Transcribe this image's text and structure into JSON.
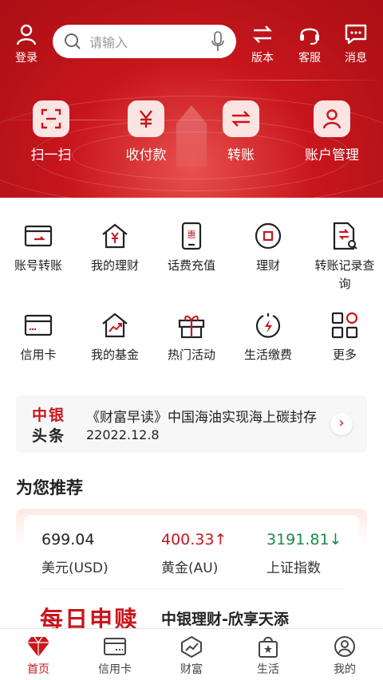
{
  "header": {
    "login_label": "登录",
    "search_placeholder": "请输入",
    "version_label": "版本",
    "service_label": "客服",
    "message_label": "消息"
  },
  "quick_actions": [
    {
      "label": "扫一扫",
      "icon": "scan-icon"
    },
    {
      "label": "收付款",
      "icon": "yuan-icon"
    },
    {
      "label": "转账",
      "icon": "transfer-arrows-icon"
    },
    {
      "label": "账户管理",
      "icon": "user-icon"
    }
  ],
  "services": [
    {
      "label": "账号转账",
      "icon": "card-transfer-icon"
    },
    {
      "label": "我的理财",
      "icon": "house-yuan-icon"
    },
    {
      "label": "话费充值",
      "icon": "phone-hui-icon"
    },
    {
      "label": "理财",
      "icon": "circle-square-icon"
    },
    {
      "label": "转账记录查询",
      "icon": "document-search-icon"
    },
    {
      "label": "信用卡",
      "icon": "credit-card-icon"
    },
    {
      "label": "我的基金",
      "icon": "house-chart-icon"
    },
    {
      "label": "热门活动",
      "icon": "gift-icon"
    },
    {
      "label": "生活缴费",
      "icon": "lightning-drop-icon"
    },
    {
      "label": "更多",
      "icon": "grid-more-icon"
    }
  ],
  "news": {
    "logo_line1": "中银",
    "logo_line2": "头条",
    "headline": "《财富早读》中国海油实现海上碳封存",
    "date": "22022.12.8"
  },
  "recommend": {
    "title": "为您推荐",
    "markets": [
      {
        "value": "699.04",
        "name": "美元(USD)",
        "color": "#222222"
      },
      {
        "value": "400.33↑",
        "name": "黄金(AU)",
        "color": "#c8161d"
      },
      {
        "value": "3191.81↓",
        "name": "上证指数",
        "color": "#1a8a4a"
      }
    ],
    "daily_label": "每日申赎",
    "product_name": "中银理财-欣享天添"
  },
  "tabbar": [
    {
      "label": "首页",
      "icon": "diamond-icon",
      "active": true
    },
    {
      "label": "信用卡",
      "icon": "credit-card-icon",
      "active": false
    },
    {
      "label": "财富",
      "icon": "wealth-chart-icon",
      "active": false
    },
    {
      "label": "生活",
      "icon": "shopping-bag-icon",
      "active": false
    },
    {
      "label": "我的",
      "icon": "profile-icon",
      "active": false
    }
  ],
  "colors": {
    "brand": "#c8161d",
    "up": "#c8161d",
    "down": "#1a8a4a"
  }
}
